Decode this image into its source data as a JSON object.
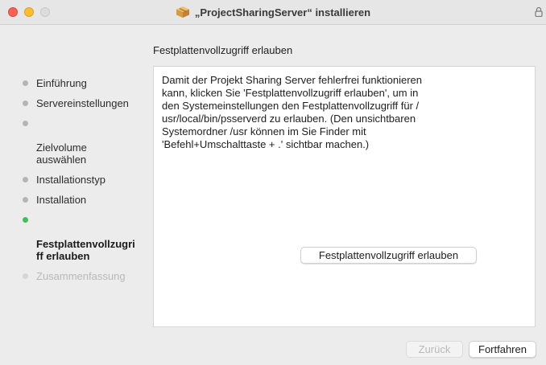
{
  "window": {
    "title": "„ProjectSharingServer“ installieren",
    "title_icon": "package-icon",
    "lock_icon": "lock-icon"
  },
  "section_title": "Festplattenvollzugriff erlauben",
  "sidebar": {
    "steps": [
      {
        "label": "Einführung",
        "state": "done"
      },
      {
        "label": "Servereinstellungen",
        "state": "done"
      },
      {
        "label": "Zielvolume\nauswählen",
        "state": "done"
      },
      {
        "label": "Installationstyp",
        "state": "done"
      },
      {
        "label": "Installation",
        "state": "done"
      },
      {
        "label": "Festplattenvollzugri\nff erlauben",
        "state": "active"
      },
      {
        "label": "Zusammenfassung",
        "state": "pending"
      }
    ]
  },
  "content": {
    "body": "Damit der Projekt Sharing Server fehlerfrei funktionieren\nkann, klicken Sie 'Festplattenvollzugriff erlauben', um in\nden Systemeinstellungen den Festplattenvollzugriff für /\nusr/local/bin/psserverd zu erlauben. (Den unsichtbaren\nSystemordner /usr können im Sie Finder mit\n'Befehl+Umschalttaste + .' sichtbar machen.)",
    "allow_button": "Festplattenvollzugriff erlauben"
  },
  "footer": {
    "back_label": "Zurück",
    "continue_label": "Fortfahren"
  },
  "colors": {
    "active_dot": "#3cc15a",
    "close": "#fe5f57",
    "minimize": "#febc2e"
  }
}
